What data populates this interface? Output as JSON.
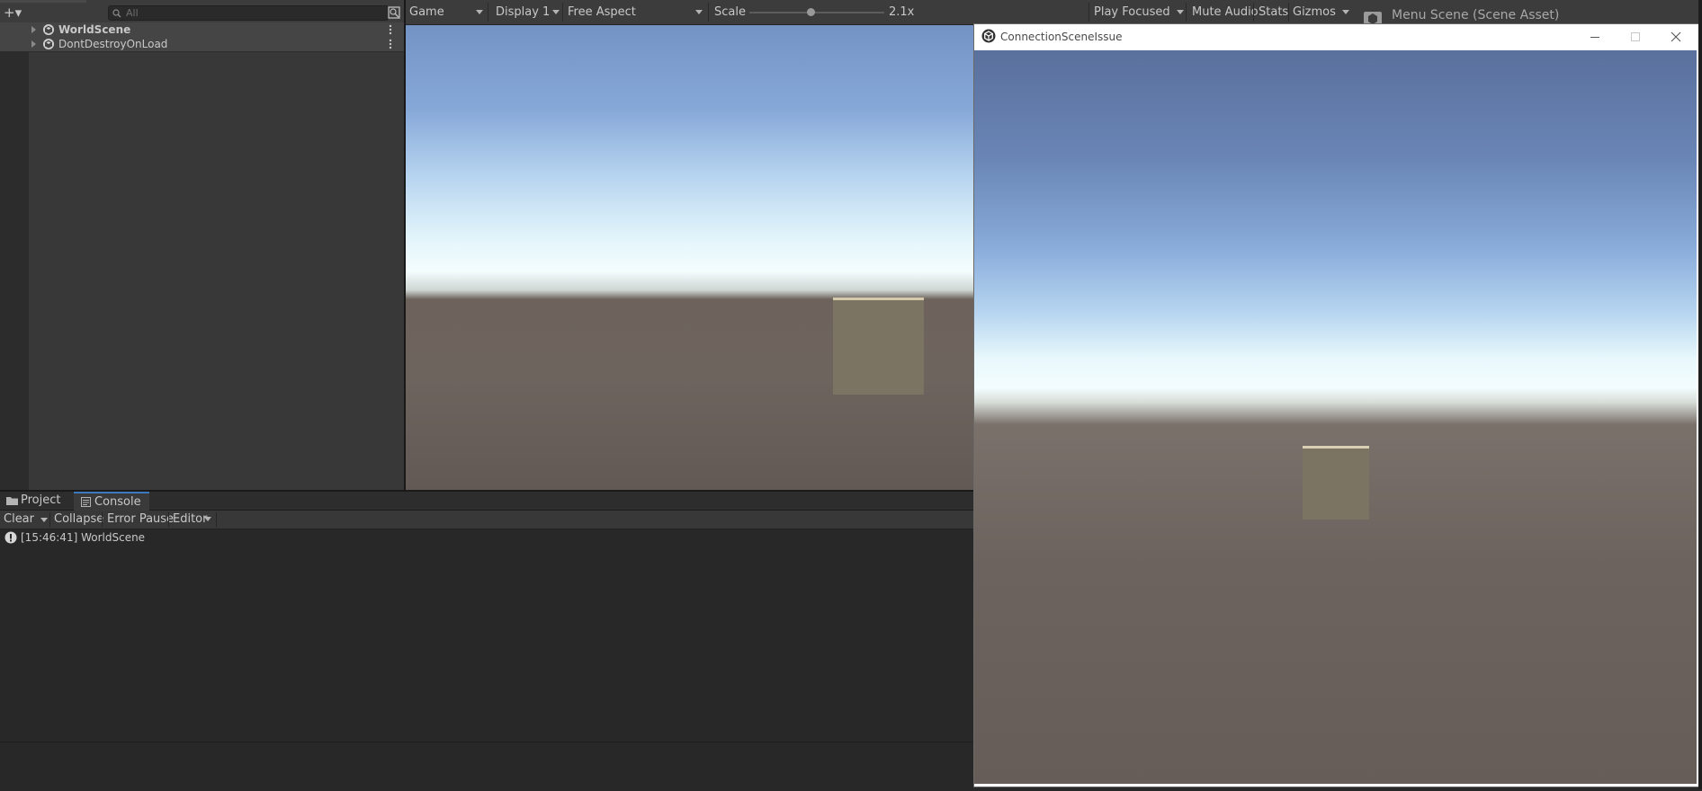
{
  "hierarchy": {
    "add_symbol": "+▾",
    "search_placeholder": "All",
    "scenes": [
      {
        "label": "WorldScene",
        "bold": true
      },
      {
        "label": "DontDestroyOnLoad",
        "bold": false
      }
    ]
  },
  "game_toolbar": {
    "view_label": "Game",
    "display_label": "Display 1",
    "aspect_label": "Free Aspect",
    "scale_label": "Scale",
    "scale_value": "2.1x",
    "play_mode_label": "Play Focused",
    "mute_label": "Mute Audio",
    "stats_label": "Stats",
    "gizmos_label": "Gizmos"
  },
  "inspector": {
    "title": "Menu Scene (Scene Asset)"
  },
  "bottom_tabs": [
    {
      "label": "Project",
      "icon": "folder-icon"
    },
    {
      "label": "Console",
      "icon": "console-icon",
      "active": true
    }
  ],
  "console_toolbar": {
    "clear_label": "Clear",
    "collapse_label": "Collapse",
    "error_pause_label": "Error Pause",
    "editor_label": "Editor"
  },
  "console_log": [
    {
      "time": "[15:46:41]",
      "message": "WorldScene",
      "icon": "info-icon"
    }
  ],
  "player_window": {
    "title": "ConnectionSceneIssue"
  },
  "colors": {
    "editor_bg": "#282828",
    "panel_bg": "#383838",
    "toolbar_bg": "#3c3c3c",
    "accent": "#3a79bb",
    "cube": "#7c7463"
  }
}
